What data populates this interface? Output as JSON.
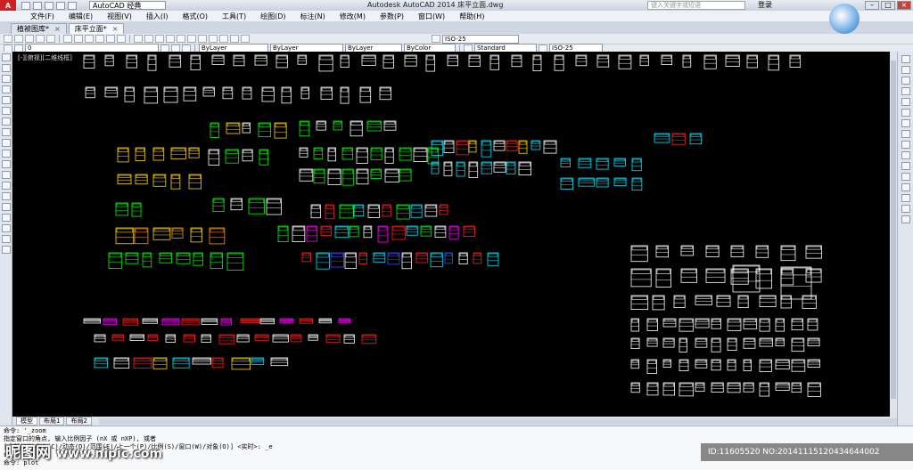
{
  "title_bar": {
    "logo": "A",
    "workspace": "AutoCAD 经典",
    "window_title": "Autodesk AutoCAD 2014    床平立面.dwg",
    "search_placeholder": "键入关键字或短语",
    "login": "登录"
  },
  "window_controls": [
    "–",
    "□",
    "×"
  ],
  "menu": [
    "文件(F)",
    "编辑(E)",
    "视图(V)",
    "插入(I)",
    "格式(O)",
    "工具(T)",
    "绘图(D)",
    "标注(N)",
    "修改(M)",
    "参数(P)",
    "窗口(W)",
    "帮助(H)"
  ],
  "doc_tabs": [
    {
      "label": "植被图库*",
      "active": false
    },
    {
      "label": "床平立面*",
      "active": true
    }
  ],
  "toolbar": {
    "layer_value": "0",
    "color_value": "ByLayer",
    "linetype_value": "ByLayer",
    "lineweight_value": "ByLayer",
    "plotstyle_value": "ByColor",
    "text_style": "Standard",
    "dim_style": "ISO-25",
    "dim_style_top": "ISO-25"
  },
  "canvas": {
    "viewport_label": "[-][俯视][二维线框]",
    "background": "#000000"
  },
  "layout_tabs": [
    {
      "label": "模型",
      "active": true
    },
    {
      "label": "布局1",
      "active": false
    },
    {
      "label": "布局2",
      "active": false
    }
  ],
  "command_lines": [
    "命令: '_zoom",
    "指定窗口的角点, 输入比例因子 (nX 或 nXP), 或者",
    "[全部(A)/中心(C)/动态(D)/范围(E)/上一个(P)/比例(S)/窗口(W)/对象(O)] <实时>: _e",
    "命令:",
    "命令: plot"
  ],
  "watermark": {
    "brand": "昵图网",
    "url": "www.nipic.com"
  },
  "id_overlay": "ID:11605520 NO:20141115120434644002",
  "colors": {
    "white": "#ffffff",
    "cyan": "#00e5ff",
    "green": "#00ff00",
    "yellow": "#ffd700",
    "red": "#ff2020",
    "magenta": "#ff00ff",
    "blue": "#3050ff",
    "orange": "#ff9900"
  }
}
